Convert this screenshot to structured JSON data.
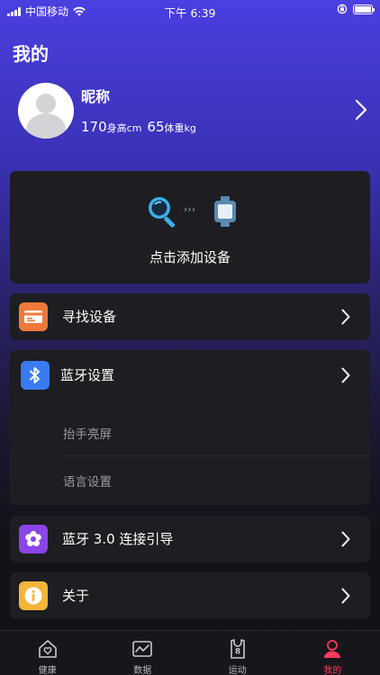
{
  "status_bar": {
    "carrier": "中国移动",
    "time": "下午 6:39"
  },
  "page": {
    "title": "我的"
  },
  "profile": {
    "nickname": "昵称",
    "height_value": "170",
    "height_unit": "身高cm",
    "weight_value": "65",
    "weight_unit": "体重kg"
  },
  "add_device": {
    "label": "点击添加设备"
  },
  "menu": {
    "find_device": "寻找设备",
    "bluetooth_settings": "蓝牙设置",
    "raise_to_wake": "抬手亮屏",
    "language_settings": "语言设置",
    "bluetooth_guide": "蓝牙 3.0 连接引导",
    "about": "关于"
  },
  "tabs": [
    {
      "label": "健康"
    },
    {
      "label": "数据"
    },
    {
      "label": "运动"
    },
    {
      "label": "我的"
    }
  ],
  "colors": {
    "accent": "#ff3b5c",
    "find_icon": "#f0793a",
    "bt_icon": "#3a7bf2",
    "guide_icon": "#8a44e8",
    "about_icon": "#f5b53a"
  }
}
